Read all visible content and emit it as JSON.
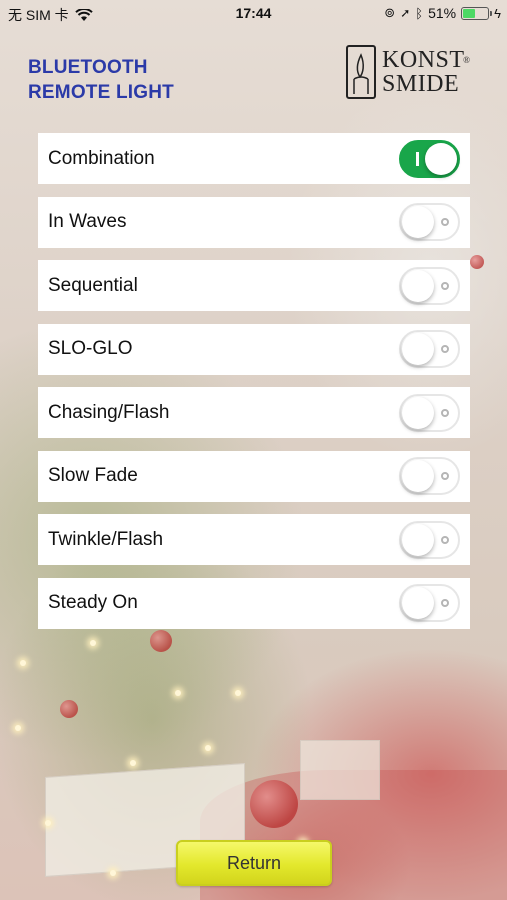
{
  "status_bar": {
    "carrier": "无 SIM 卡",
    "time": "17:44",
    "battery_percent": "51%",
    "battery_level": 0.51
  },
  "header": {
    "title_line1": "BLUETOOTH",
    "title_line2": "REMOTE LIGHT",
    "logo_line1": "KONST",
    "logo_line2": "SMIDE",
    "logo_reg": "®"
  },
  "modes": [
    {
      "label": "Combination",
      "on": true
    },
    {
      "label": "In Waves",
      "on": false
    },
    {
      "label": "Sequential",
      "on": false
    },
    {
      "label": "SLO-GLO",
      "on": false
    },
    {
      "label": "Chasing/Flash",
      "on": false
    },
    {
      "label": "Slow Fade",
      "on": false
    },
    {
      "label": "Twinkle/Flash",
      "on": false
    },
    {
      "label": "Steady On",
      "on": false
    }
  ],
  "return_label": "Return",
  "colors": {
    "title": "#2b3aa8",
    "toggle_on": "#19a64a",
    "return_button": "#e3e82c"
  }
}
